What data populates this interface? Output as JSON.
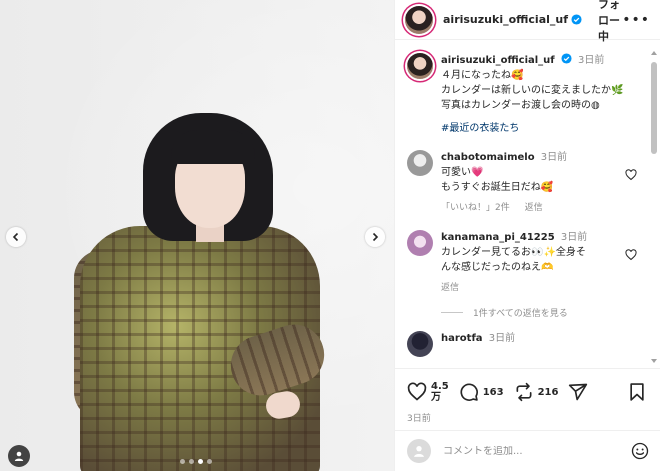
{
  "post": {
    "username": "airisuzuki_official_uf",
    "follow_label": "フォロー中",
    "more_label": "•••",
    "photo": {
      "slide_count": 4,
      "active_slide": 3
    }
  },
  "caption": {
    "username": "airisuzuki_official_uf",
    "time": "3日前",
    "line1": "４月になったね🥰",
    "line2": "カレンダーは新しいのに変えましたか🌿",
    "line3": "写真はカレンダーお渡し会の時の◍",
    "hashtag": "#最近の衣装たち"
  },
  "comments": [
    {
      "username": "chabotomaimelo",
      "time": "3日前",
      "line1": "可愛い💗",
      "line2": "もうすぐお誕生日だね🥰",
      "likes": "「いいね！」2件",
      "reply": "返信"
    },
    {
      "username": "kanamana_pi_41225",
      "time": "3日前",
      "line1": "カレンダー見てるお👀✨全身そ",
      "line2": "んな感じだったのねえ🫶",
      "reply": "返信",
      "view_replies": "1件すべての返信を見る"
    },
    {
      "username": "harotfa",
      "time": "3日前"
    }
  ],
  "actions": {
    "likes_count_top": "4.5",
    "likes_count_bottom": "万",
    "comments_count": "163",
    "reposts_count": "216",
    "posted": "3日前"
  },
  "composer": {
    "placeholder": "コメントを追加..."
  },
  "colors": {
    "verified": "#0095f6",
    "link": "#00376b",
    "muted": "#8e8e8e"
  },
  "icons": [
    "chevron-left-icon",
    "chevron-right-icon",
    "person-tag-icon",
    "verified-icon",
    "heart-icon",
    "comment-icon",
    "repost-icon",
    "share-icon",
    "bookmark-icon",
    "emoji-icon"
  ]
}
